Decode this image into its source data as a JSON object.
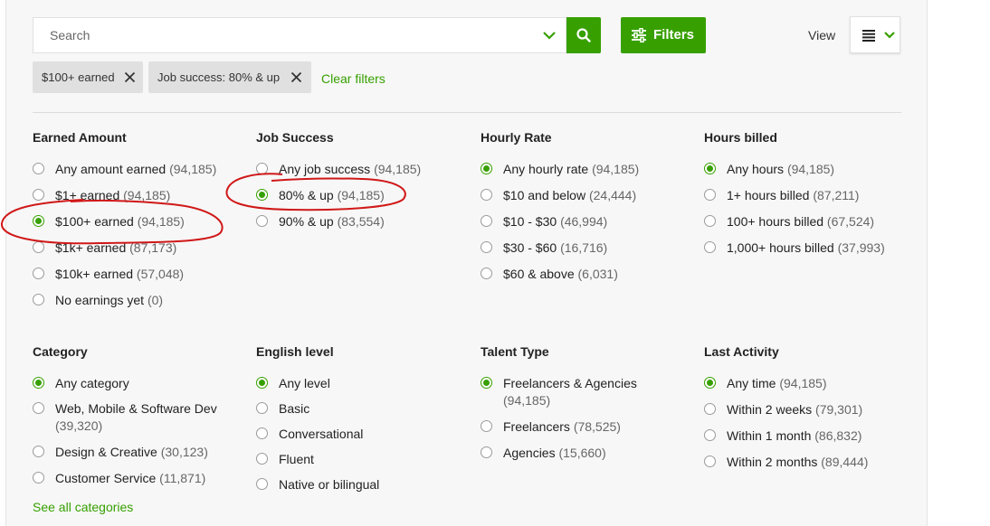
{
  "search": {
    "placeholder": "Search"
  },
  "filters_button": {
    "label": "Filters"
  },
  "view": {
    "label": "View"
  },
  "chips": [
    {
      "label": "$100+ earned"
    },
    {
      "label": "Job success: 80% & up"
    }
  ],
  "clear_filters": "Clear filters",
  "see_all_categories": "See all categories",
  "colors": {
    "accent": "#37a000",
    "annotation": "#d01818"
  },
  "groups": {
    "earned": {
      "title": "Earned Amount",
      "options": [
        {
          "label": "Any amount earned",
          "count": "(94,185)",
          "selected": false
        },
        {
          "label": "$1+ earned",
          "count": "(94,185)",
          "selected": false
        },
        {
          "label": "$100+ earned",
          "count": "(94,185)",
          "selected": true
        },
        {
          "label": "$1k+ earned",
          "count": "(87,173)",
          "selected": false
        },
        {
          "label": "$10k+ earned",
          "count": "(57,048)",
          "selected": false
        },
        {
          "label": "No earnings yet",
          "count": "(0)",
          "selected": false
        }
      ]
    },
    "job_success": {
      "title": "Job Success",
      "options": [
        {
          "label": "Any job success",
          "count": "(94,185)",
          "selected": false
        },
        {
          "label": "80% & up",
          "count": "(94,185)",
          "selected": true
        },
        {
          "label": "90% & up",
          "count": "(83,554)",
          "selected": false
        }
      ]
    },
    "hourly": {
      "title": "Hourly Rate",
      "options": [
        {
          "label": "Any hourly rate",
          "count": "(94,185)",
          "selected": true
        },
        {
          "label": "$10 and below",
          "count": "(24,444)",
          "selected": false
        },
        {
          "label": "$10 - $30",
          "count": "(46,994)",
          "selected": false
        },
        {
          "label": "$30 - $60",
          "count": "(16,716)",
          "selected": false
        },
        {
          "label": "$60 & above",
          "count": "(6,031)",
          "selected": false
        }
      ]
    },
    "hours_billed": {
      "title": "Hours billed",
      "options": [
        {
          "label": "Any hours",
          "count": "(94,185)",
          "selected": true
        },
        {
          "label": "1+ hours billed",
          "count": "(87,211)",
          "selected": false
        },
        {
          "label": "100+ hours billed",
          "count": "(67,524)",
          "selected": false
        },
        {
          "label": "1,000+ hours billed",
          "count": "(37,993)",
          "selected": false
        }
      ]
    },
    "category": {
      "title": "Category",
      "options": [
        {
          "label": "Any category",
          "count": "",
          "selected": true
        },
        {
          "label": "Web, Mobile & Software Dev",
          "count": "(39,320)",
          "selected": false
        },
        {
          "label": "Design & Creative",
          "count": "(30,123)",
          "selected": false
        },
        {
          "label": "Customer Service",
          "count": "(11,871)",
          "selected": false
        }
      ]
    },
    "english": {
      "title": "English level",
      "options": [
        {
          "label": "Any level",
          "count": "",
          "selected": true
        },
        {
          "label": "Basic",
          "count": "",
          "selected": false
        },
        {
          "label": "Conversational",
          "count": "",
          "selected": false
        },
        {
          "label": "Fluent",
          "count": "",
          "selected": false
        },
        {
          "label": "Native or bilingual",
          "count": "",
          "selected": false
        }
      ]
    },
    "talent": {
      "title": "Talent Type",
      "options": [
        {
          "label": "Freelancers & Agencies",
          "count": "(94,185)",
          "selected": true
        },
        {
          "label": "Freelancers",
          "count": "(78,525)",
          "selected": false
        },
        {
          "label": "Agencies",
          "count": "(15,660)",
          "selected": false
        }
      ]
    },
    "last_activity": {
      "title": "Last Activity",
      "options": [
        {
          "label": "Any time",
          "count": "(94,185)",
          "selected": true
        },
        {
          "label": "Within 2 weeks",
          "count": "(79,301)",
          "selected": false
        },
        {
          "label": "Within 1 month",
          "count": "(86,832)",
          "selected": false
        },
        {
          "label": "Within 2 months",
          "count": "(89,444)",
          "selected": false
        }
      ]
    }
  }
}
